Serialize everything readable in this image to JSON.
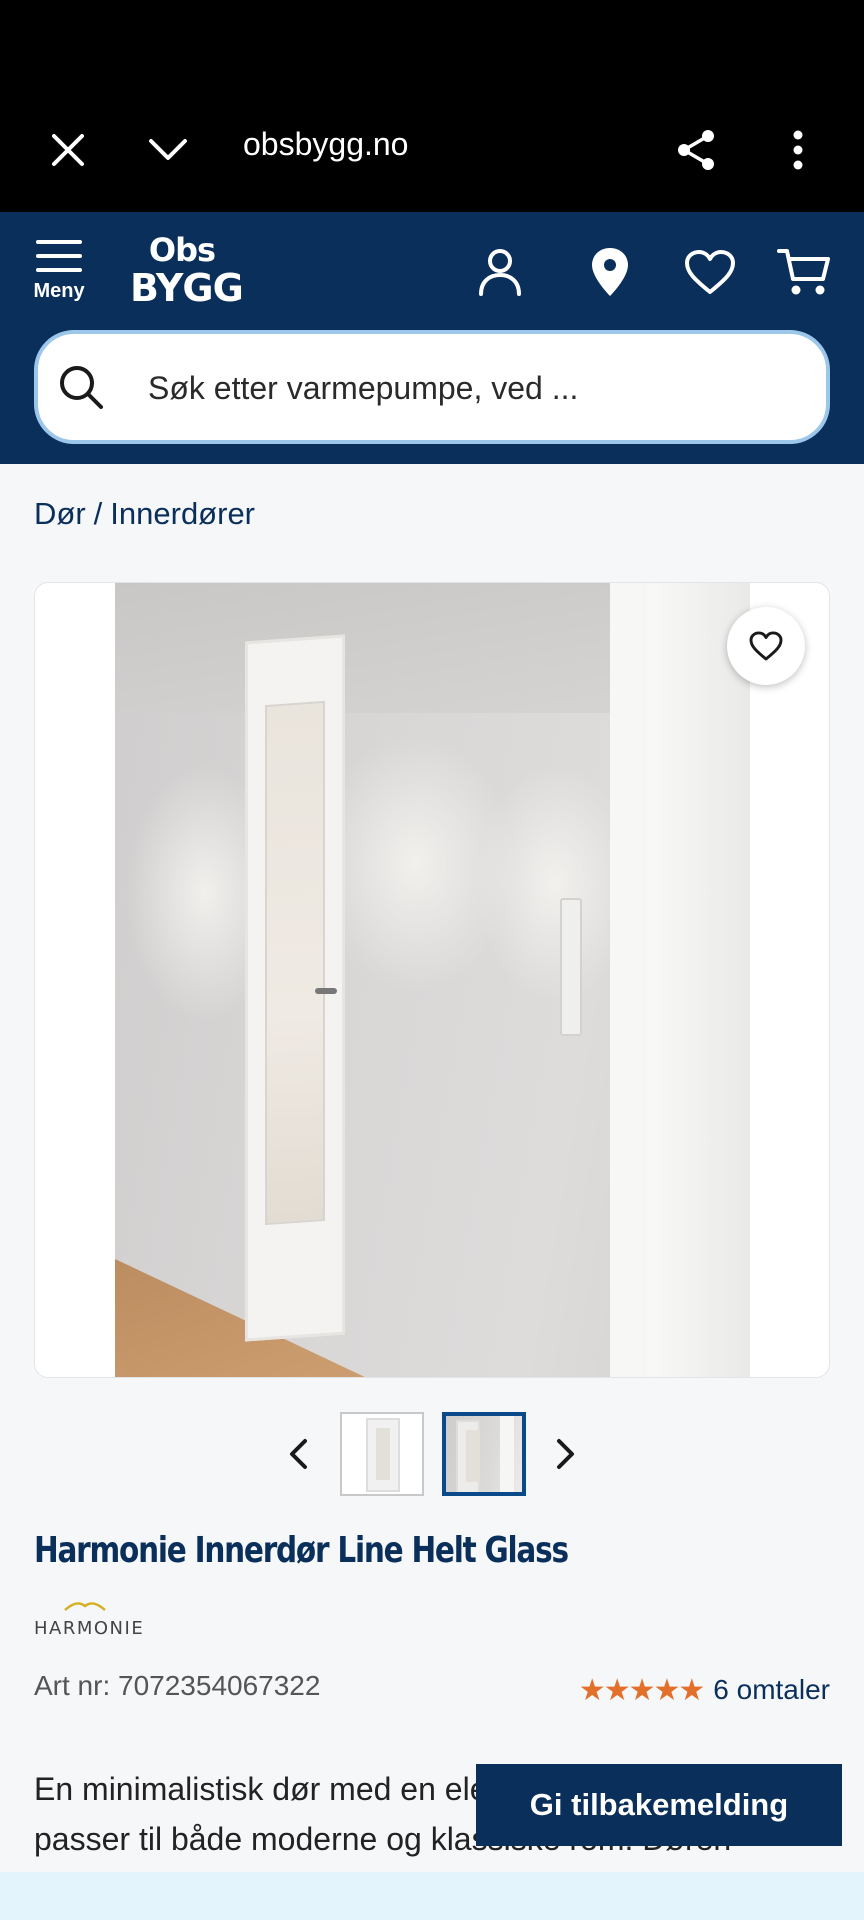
{
  "browser": {
    "url": "obsbygg.no",
    "icons": [
      "close-icon",
      "chevron-down-icon",
      "share-icon",
      "more-vert-icon"
    ]
  },
  "header": {
    "menu_label": "Meny",
    "logo_line1": "Obs",
    "logo_line2": "BYGG",
    "search_placeholder": "Søk etter varmepumpe, ved ...",
    "icons": [
      "user-icon",
      "location-pin-icon",
      "heart-icon",
      "cart-icon"
    ]
  },
  "breadcrumb": {
    "items": [
      "Dør",
      "Innerdører"
    ],
    "separator": "/"
  },
  "product": {
    "title": "Harmonie Innerdør Line Helt Glass",
    "brand": "HARMONIE",
    "art_nr": "Art nr: 7072354067322",
    "rating_stars": "★★★★★",
    "rating_value": 5,
    "reviews": "6 omtaler",
    "description": "En minimalistisk dør med en elegant glassflate som passer til både moderne og klassiske rom. Døren leveres i"
  },
  "gallery": {
    "thumbnail_count": 2,
    "active_thumbnail": 2
  },
  "feedback": {
    "label": "Gi tilbakemelding"
  },
  "colors": {
    "brand_navy": "#0b2f5b",
    "star_orange": "#e2702a",
    "search_border": "#9cc6ea"
  }
}
